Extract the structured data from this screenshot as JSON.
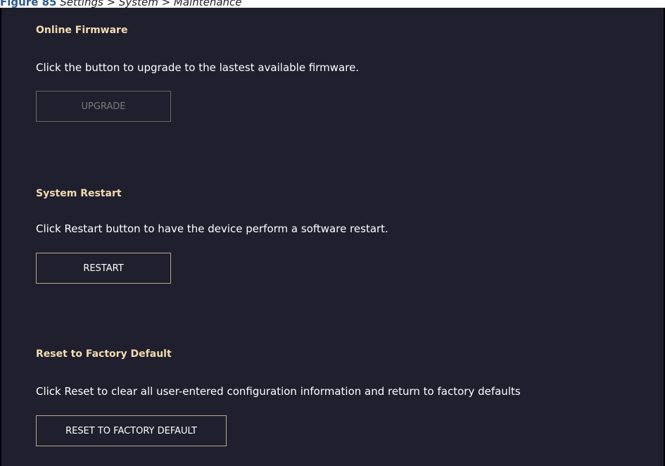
{
  "figure": {
    "number": "Figure 85",
    "title": "Settings > System > Maintenance"
  },
  "sections": {
    "online_firmware": {
      "title": "Online Firmware",
      "description": "Click the button to upgrade to the lastest available firmware.",
      "button_label": "UPGRADE",
      "button_disabled": true
    },
    "system_restart": {
      "title": "System Restart",
      "description": "Click Restart button to have the device perform a software restart.",
      "button_label": "RESTART"
    },
    "reset_factory": {
      "title": "Reset to Factory Default",
      "description": "Click Reset to clear all user-entered configuration information and return to factory defaults",
      "button_label": "RESET TO FACTORY DEFAULT"
    }
  },
  "colors": {
    "panel_background": "#1f1f2e",
    "section_title": "#f2dcb0",
    "text": "#ffffff",
    "button_border": "#b9a988",
    "button_disabled_text": "#7e7a74"
  }
}
